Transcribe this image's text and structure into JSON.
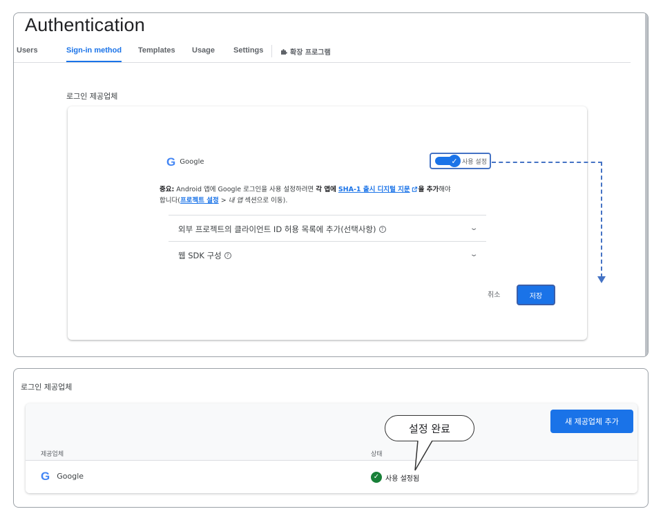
{
  "page_title": "Authentication",
  "tabs": [
    "Users",
    "Sign-in method",
    "Templates",
    "Usage",
    "Settings"
  ],
  "extension_tab": "확장 프로그램",
  "section_label": "로그인 제공업체",
  "provider": {
    "name": "Google",
    "icon": "google-g-icon",
    "toggle_label": "사용 설정",
    "enabled": true
  },
  "notice": {
    "bold_prefix": "중요:",
    "text1": " Android 앱에 Google 로그인을 사용 설정하려면 ",
    "bold_mid": "각 앱에",
    "space": " ",
    "link_sha": "SHA-1 출시 디지털 지문",
    "bold_after": "을 추가",
    "text2": "해야",
    "text3": "합니다(",
    "link_project": "프로젝트 설정",
    "text4": " > ",
    "italic_app": "내 앱",
    "text5": " 섹션으로 이동)."
  },
  "expanders": [
    {
      "label": "외부 프로젝트의 클라이언트 ID 허용 목록에 추가(선택사항)"
    },
    {
      "label": "웹 SDK 구성"
    }
  ],
  "buttons": {
    "cancel": "취소",
    "save": "저장",
    "add_provider": "새 제공업체 추가"
  },
  "table": {
    "section_label": "로그인 제공업체",
    "columns": [
      "제공업체",
      "상태"
    ],
    "rows": [
      {
        "provider": "Google",
        "status": "사용 설정됨"
      }
    ]
  },
  "callout": "설정 완료",
  "colors": {
    "accent": "#1a73e8",
    "annotation": "#4472c4",
    "success": "#188038"
  }
}
